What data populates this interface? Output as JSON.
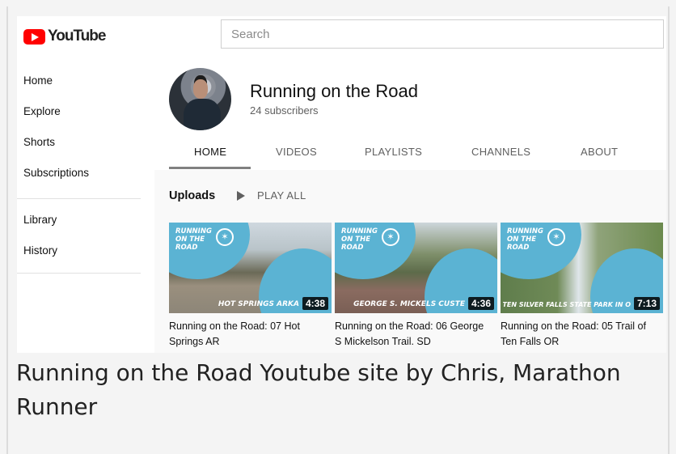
{
  "header": {
    "logo_text": "YouTube",
    "search_placeholder": "Search"
  },
  "sidebar": {
    "primary": [
      "Home",
      "Explore",
      "Shorts",
      "Subscriptions"
    ],
    "secondary": [
      "Library",
      "History"
    ]
  },
  "channel": {
    "name": "Running on the Road",
    "subscribers": "24 subscribers",
    "tabs": [
      "HOME",
      "VIDEOS",
      "PLAYLISTS",
      "CHANNELS",
      "ABOUT"
    ],
    "active_tab": "HOME"
  },
  "uploads": {
    "label": "Uploads",
    "play_all": "PLAY ALL",
    "videos": [
      {
        "title": "Running on the Road: 07 Hot Springs AR",
        "duration": "4:38",
        "thumb_brand": "RUNNING ON THE ROAD",
        "thumb_place": "HOT SPRINGS ARKA"
      },
      {
        "title": "Running on the Road: 06 George S Mickelson Trail. SD",
        "duration": "4:36",
        "thumb_brand": "RUNNING ON THE ROAD",
        "thumb_place": "GEORGE S. MICKELS CUSTE"
      },
      {
        "title": "Running on the Road: 05 Trail of Ten Falls OR",
        "duration": "7:13",
        "thumb_brand": "RUNNING ON THE ROAD",
        "thumb_place": "TRAIL OF TEN SILVER FALLS STATE PARK IN O"
      }
    ]
  },
  "caption": "Running on the Road Youtube site by Chris, Marathon Runner",
  "colors": {
    "brand_red": "#ff0000",
    "thumb_blue": "#5bb3d3"
  }
}
